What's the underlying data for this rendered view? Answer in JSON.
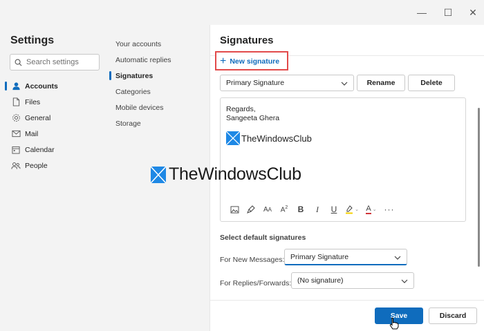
{
  "window": {
    "minimize": "—",
    "maximize": "☐",
    "close": "✕"
  },
  "settings": {
    "title": "Settings",
    "search_placeholder": "Search settings",
    "nav": [
      {
        "label": "Accounts",
        "icon": "person-icon"
      },
      {
        "label": "Files",
        "icon": "file-icon"
      },
      {
        "label": "General",
        "icon": "gear-icon"
      },
      {
        "label": "Mail",
        "icon": "mail-icon"
      },
      {
        "label": "Calendar",
        "icon": "calendar-icon"
      },
      {
        "label": "People",
        "icon": "people-icon"
      }
    ]
  },
  "subnav": [
    "Your accounts",
    "Automatic replies",
    "Signatures",
    "Categories",
    "Mobile devices",
    "Storage"
  ],
  "signatures": {
    "title": "Signatures",
    "new_signature": "New signature",
    "selected_signature": "Primary Signature",
    "rename_label": "Rename",
    "delete_label": "Delete",
    "body_line1": "Regards,",
    "body_line2": "Sangeeta Ghera",
    "logo_text": "TheWindowsClub",
    "defaults_heading": "Select default signatures",
    "new_messages_label": "For New Messages:",
    "new_messages_value": "Primary Signature",
    "replies_label": "For Replies/Forwards:",
    "replies_value": "(No signature)"
  },
  "footer": {
    "save_label": "Save",
    "discard_label": "Discard"
  },
  "watermark": {
    "text": "TheWindowsClub"
  },
  "colors": {
    "accent": "#0f6cbd",
    "highlight_box": "#e24a4a",
    "logo_blue": "#1e88e5"
  }
}
